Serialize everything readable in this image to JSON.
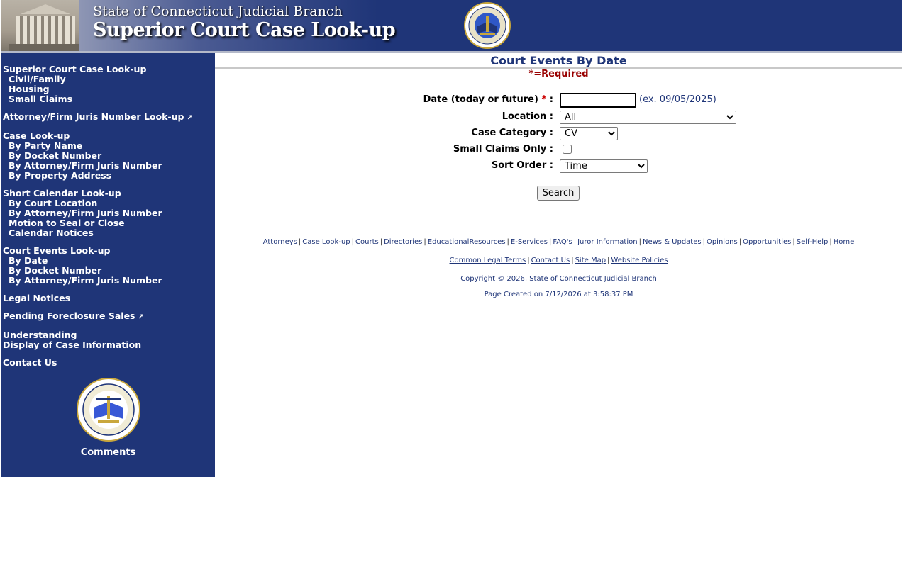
{
  "header": {
    "line1": "State of Connecticut Judicial Branch",
    "line2": "Superior Court Case Look-up"
  },
  "sidebar": {
    "groups": [
      {
        "head": "Superior Court Case Look-up",
        "items": [
          "Civil/Family",
          "Housing",
          "Small Claims"
        ]
      },
      {
        "head": "Attorney/Firm Juris Number Look-up",
        "external": true,
        "items": []
      },
      {
        "head": "Case Look-up",
        "items": [
          "By Party Name",
          "By Docket Number",
          "By Attorney/Firm Juris Number",
          "By Property Address"
        ]
      },
      {
        "head": "Short Calendar Look-up",
        "items": [
          "By Court Location",
          "By Attorney/Firm Juris Number",
          "Motion to Seal or Close",
          "Calendar Notices"
        ]
      },
      {
        "head": "Court Events Look-up",
        "items": [
          "By Date",
          "By Docket Number",
          "By Attorney/Firm Juris Number"
        ]
      },
      {
        "head": "Legal Notices",
        "items": []
      },
      {
        "head": "Pending Foreclosure Sales",
        "external": true,
        "items": []
      },
      {
        "head": "Understanding",
        "items": []
      },
      {
        "head": "Display of Case Information",
        "items": []
      },
      {
        "head": "Contact Us",
        "items": []
      }
    ],
    "comments": "Comments"
  },
  "main": {
    "title": "Court Events By Date",
    "required_note": "*=Required",
    "form": {
      "date_label": "Date (today or future)",
      "required_star": "*",
      "colon": ":",
      "date_value": "",
      "date_example": "(ex. 09/05/2025)",
      "location_label": "Location :",
      "location_selected": "All",
      "category_label": "Case Category :",
      "category_selected": "CV",
      "small_claims_label": "Small Claims Only :",
      "small_claims_checked": false,
      "sort_label": "Sort Order :",
      "sort_selected": "Time",
      "search_label": "Search"
    }
  },
  "footer": {
    "links_row1": [
      "Attorneys",
      "Case Look-up",
      "Courts",
      "Directories",
      "EducationalResources",
      "E-Services",
      "FAQ's",
      "Juror Information",
      "News & Updates",
      "Opinions",
      "Opportunities",
      "Self-Help",
      "Home"
    ],
    "links_row2": [
      "Common Legal Terms",
      "Contact Us",
      "Site Map",
      "Website Policies"
    ],
    "copyright": "Copyright © 2026, State of Connecticut Judicial Branch",
    "page_created": "Page Created on 7/12/2026 at 3:58:37 PM"
  },
  "colors": {
    "brand_navy": "#1f3578",
    "required_red": "#990000"
  }
}
